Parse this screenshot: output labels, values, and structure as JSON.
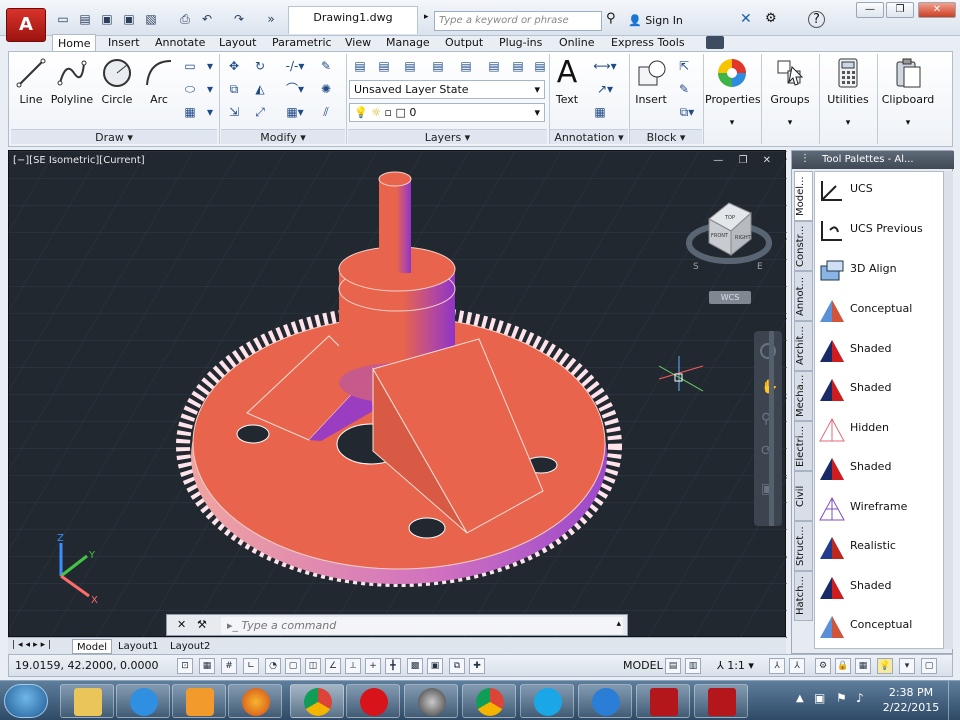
{
  "titlebar": {
    "app_logo": "A",
    "doc_title": "Drawing1.dwg",
    "search_placeholder": "Type a keyword or phrase",
    "sign_in": "Sign In",
    "minimize": "—",
    "maximize": "❐",
    "close": "✕"
  },
  "tabs": [
    "Home",
    "Insert",
    "Annotate",
    "Layout",
    "Parametric",
    "View",
    "Manage",
    "Output",
    "Plug-ins",
    "Online",
    "Express Tools"
  ],
  "ribbon": {
    "draw": {
      "label": "Draw",
      "tools": [
        "Line",
        "Polyline",
        "Circle",
        "Arc"
      ]
    },
    "modify": {
      "label": "Modify"
    },
    "layers": {
      "label": "Layers",
      "layer_state": "Unsaved Layer State",
      "current_layer": "0"
    },
    "annotation": {
      "label": "Annotation",
      "text_tool": "Text"
    },
    "block": {
      "label": "Block",
      "insert_tool": "Insert"
    },
    "properties": "Properties",
    "groups": "Groups",
    "utilities": "Utilities",
    "clipboard": "Clipboard"
  },
  "viewport": {
    "label": "[−][SE Isometric][Current]",
    "wcs": "WCS",
    "viewcube_top": "TOP",
    "viewcube_front": "FRONT",
    "viewcube_right": "RIGHT",
    "compass_s": "S",
    "compass_e": "E",
    "axis_x": "X",
    "axis_y": "Y",
    "axis_z": "Z"
  },
  "command": {
    "placeholder": "Type a command"
  },
  "layout_tabs": [
    "Model",
    "Layout1",
    "Layout2"
  ],
  "status": {
    "coords": "19.0159, 42.2000, 0.0000",
    "model": "MODEL",
    "scale": "1:1"
  },
  "palette": {
    "title": "Tool Palettes - Al...",
    "tabs": [
      "Model...",
      "Constr...",
      "Annot...",
      "Archit...",
      "Mecha...",
      "Electri...",
      "Civil",
      "Struct...",
      "Hatch..."
    ],
    "items": [
      "UCS",
      "UCS Previous",
      "3D Align",
      "Conceptual",
      "Shaded",
      "Shaded",
      "Hidden",
      "Shaded",
      "Wireframe",
      "Realistic",
      "Shaded",
      "Conceptual"
    ]
  },
  "taskbar": {
    "time": "2:38 PM",
    "date": "2/22/2015"
  },
  "colors": {
    "model": "#e8644c",
    "model_shade": "#a93ab8",
    "viewport_bg": "#212830",
    "accent": "#2b6fc2"
  }
}
